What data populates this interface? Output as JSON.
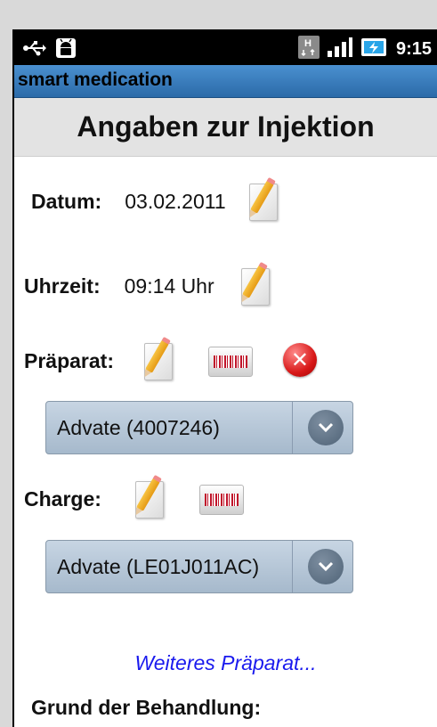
{
  "status_bar": {
    "time": "9:15",
    "icons": [
      "usb-icon",
      "android-debug-icon",
      "hspa-icon",
      "signal-icon",
      "battery-charging-icon"
    ]
  },
  "app": {
    "title": "smart medication"
  },
  "page": {
    "heading": "Angaben zur Injektion"
  },
  "date": {
    "label": "Datum:",
    "value": "03.02.2011"
  },
  "time": {
    "label": "Uhrzeit:",
    "value": "09:14 Uhr"
  },
  "preparation": {
    "label": "Präparat:",
    "selected": "Advate (4007246)"
  },
  "batch": {
    "label": "Charge:",
    "selected": "Advate (LE01J011AC)"
  },
  "more_link": "Weiteres Präparat...",
  "reason": {
    "label": "Grund der Behandlung:"
  },
  "colors": {
    "link": "#1a1aee",
    "appbar": "#3a7ebf",
    "delete": "#d81818"
  }
}
